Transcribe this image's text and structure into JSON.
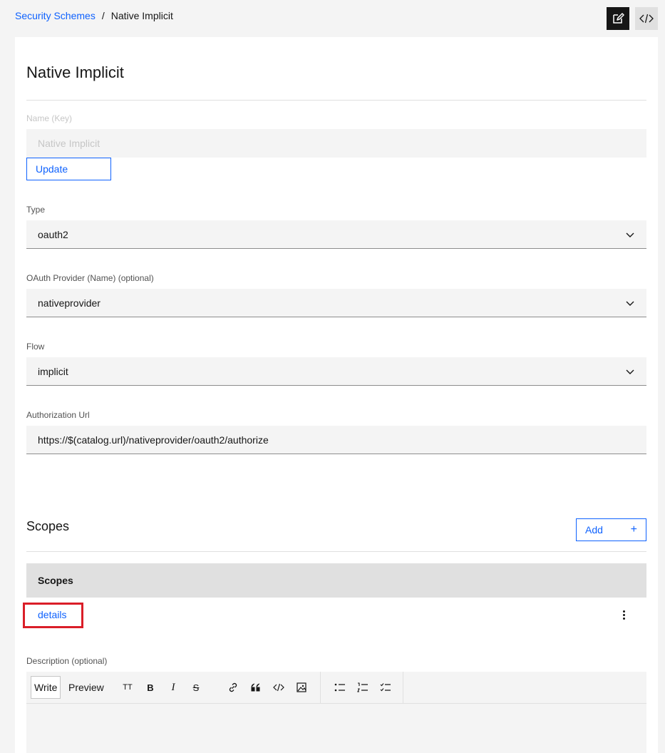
{
  "breadcrumb": {
    "parent": "Security Schemes",
    "separator": "/",
    "current": "Native Implicit"
  },
  "header_actions": {
    "edit_icon": "edit-icon",
    "code_icon": "code-icon"
  },
  "page": {
    "title": "Native Implicit"
  },
  "fields": {
    "name": {
      "label": "Name (Key)",
      "value": "Native Implicit",
      "disabled": true
    },
    "update_button": "Update",
    "type": {
      "label": "Type",
      "value": "oauth2"
    },
    "provider": {
      "label": "OAuth Provider (Name) (optional)",
      "value": "nativeprovider"
    },
    "flow": {
      "label": "Flow",
      "value": "implicit"
    },
    "auth_url": {
      "label": "Authorization Url",
      "value": "https://$(catalog.url)/nativeprovider/oauth2/authorize"
    }
  },
  "scopes": {
    "title": "Scopes",
    "add_button": "Add",
    "add_icon": "+",
    "table_header": "Scopes",
    "rows": [
      {
        "name": "details"
      }
    ]
  },
  "description": {
    "label": "Description (optional)",
    "tabs": [
      "Write",
      "Preview"
    ],
    "toolbar": {
      "heading": "TT",
      "bold": "B",
      "italic": "I",
      "strikethrough": "S"
    }
  },
  "colors": {
    "accent": "#0f62fe",
    "highlight": "#da1e28",
    "background": "#f4f4f4"
  }
}
